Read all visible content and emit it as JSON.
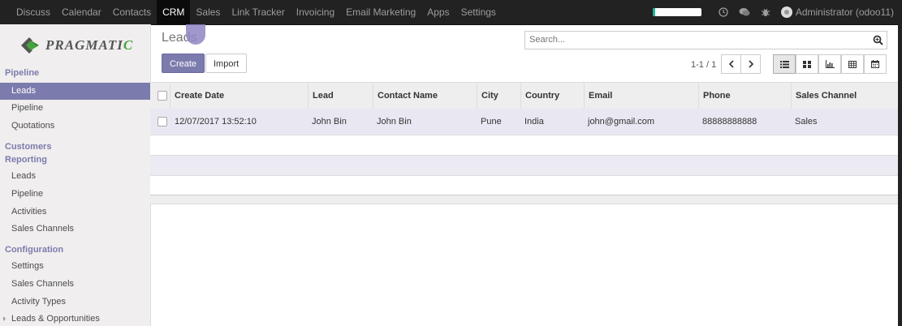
{
  "topbar": {
    "menu": [
      "Discuss",
      "Calendar",
      "Contacts",
      "CRM",
      "Sales",
      "Link Tracker",
      "Invoicing",
      "Email Marketing",
      "Apps",
      "Settings"
    ],
    "active": "CRM",
    "user": "Administrator (odoo11)",
    "progress_fraction": 0.05,
    "icons": [
      "clock-icon",
      "chat-icon",
      "bug-icon"
    ]
  },
  "logo": {
    "prefix": "P",
    "main": "RAGMATI",
    "suffix": "C"
  },
  "sidebar": {
    "pipeline_header": "Pipeline",
    "pipeline_items": [
      "Leads",
      "Pipeline",
      "Quotations"
    ],
    "customers_header": "Customers",
    "reporting_header": "Reporting",
    "reporting_items": [
      "Leads",
      "Pipeline",
      "Activities",
      "Sales Channels"
    ],
    "config_header": "Configuration",
    "config_items": [
      "Settings",
      "Sales Channels",
      "Activity Types",
      "Leads & Opportunities"
    ]
  },
  "main": {
    "breadcrumb": "Leads",
    "create_label": "Create",
    "import_label": "Import",
    "search_placeholder": "Search...",
    "pager": "1-1 / 1"
  },
  "table": {
    "columns": [
      "Create Date",
      "Lead",
      "Contact Name",
      "City",
      "Country",
      "Email",
      "Phone",
      "Sales Channel"
    ],
    "rows": [
      [
        "12/07/2017 13:52:10",
        "John Bin",
        "John Bin",
        "Pune",
        "India",
        "john@gmail.com",
        "88888888888",
        "Sales"
      ]
    ]
  },
  "colors": {
    "accent": "#7c7bad",
    "topbar": "#222222",
    "sidebar": "#f0eeee"
  }
}
